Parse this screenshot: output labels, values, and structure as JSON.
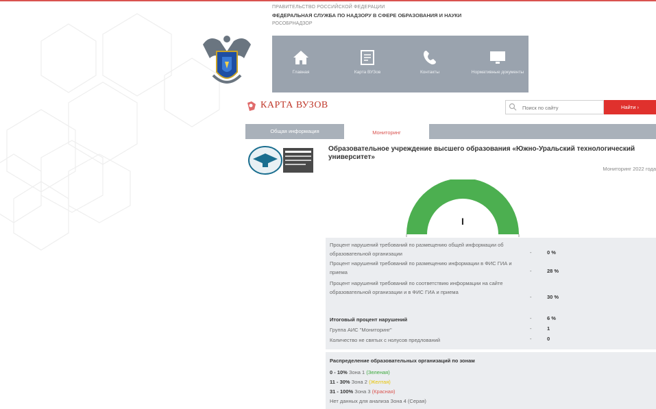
{
  "header": {
    "government": "ПРАВИТЕЛЬСТВО РОССИЙСКОЙ ФЕДЕРАЦИИ",
    "agency": "ФЕДЕРАЛЬНАЯ СЛУЖБА ПО НАДЗОРУ В СФЕРЕ ОБРАЗОВАНИЯ И НАУКИ",
    "agency_short": "РОСОБРНАДЗОР"
  },
  "nav": {
    "items": [
      {
        "label": "Главная",
        "icon": "home-icon"
      },
      {
        "label": "Карта ВУЗов",
        "icon": "map-icon"
      },
      {
        "label": "Контакты",
        "icon": "phone-icon"
      },
      {
        "label": "Нормативные документы",
        "icon": "monitor-icon"
      }
    ]
  },
  "page": {
    "title": "КАРТА ВУЗОВ",
    "search_placeholder": "Поиск по сайту",
    "search_button": "Найти"
  },
  "tabs": [
    {
      "label": "Общая информация",
      "active": false
    },
    {
      "label": "Мониторинг",
      "active": true
    }
  ],
  "organization": {
    "title": "Образовательное учреждение высшего образования «Южно-Уральский технологический университет»",
    "monitoring_year": "Мониторинг 2022 года"
  },
  "gauge": {
    "value_label": "I",
    "color": "#4caf50"
  },
  "stats": [
    {
      "label": "Процент нарушений требований по размещению общей информации об образовательной организации",
      "value": "0 %",
      "bold": false
    },
    {
      "label": "Процент нарушений требований по размещению информации в ФИС ГИА и приема",
      "value": "28 %",
      "bold": false
    },
    {
      "label": "Процент нарушений требований по соответствию информации на сайте образовательной организации и в ФИС ГИА и приема",
      "value": "30 %",
      "bold": false
    },
    {
      "label": "Итоговый процент нарушений",
      "value": "6 %",
      "bold": true
    },
    {
      "label": "Группа АИС \"Мониторинг\"",
      "value": "1",
      "bold": false
    },
    {
      "label": "Количество не святых с нолусов предлований",
      "value": "0",
      "bold": false
    }
  ],
  "zones": {
    "title": "Распределение образовательных организаций по зонам",
    "rows": [
      {
        "range": "0 - 10%",
        "zone": "Зона 1",
        "color_name": "(Зеленая)",
        "color": "#3aa83a"
      },
      {
        "range": "11 - 30%",
        "zone": "Зона 2",
        "color_name": "(Желтая)",
        "color": "#e6c300"
      },
      {
        "range": "31 - 100%",
        "zone": "Зона 3",
        "color_name": "(Красная)",
        "color": "#d9534f"
      }
    ],
    "no_data": "Нет данных для анализа Зона 4 (Серая)"
  },
  "colors": {
    "accent_red": "#e0312d",
    "nav_bg": "#9aa3ae",
    "tabs_bg": "#a9b1ba",
    "panel_bg": "#ebedf0"
  }
}
